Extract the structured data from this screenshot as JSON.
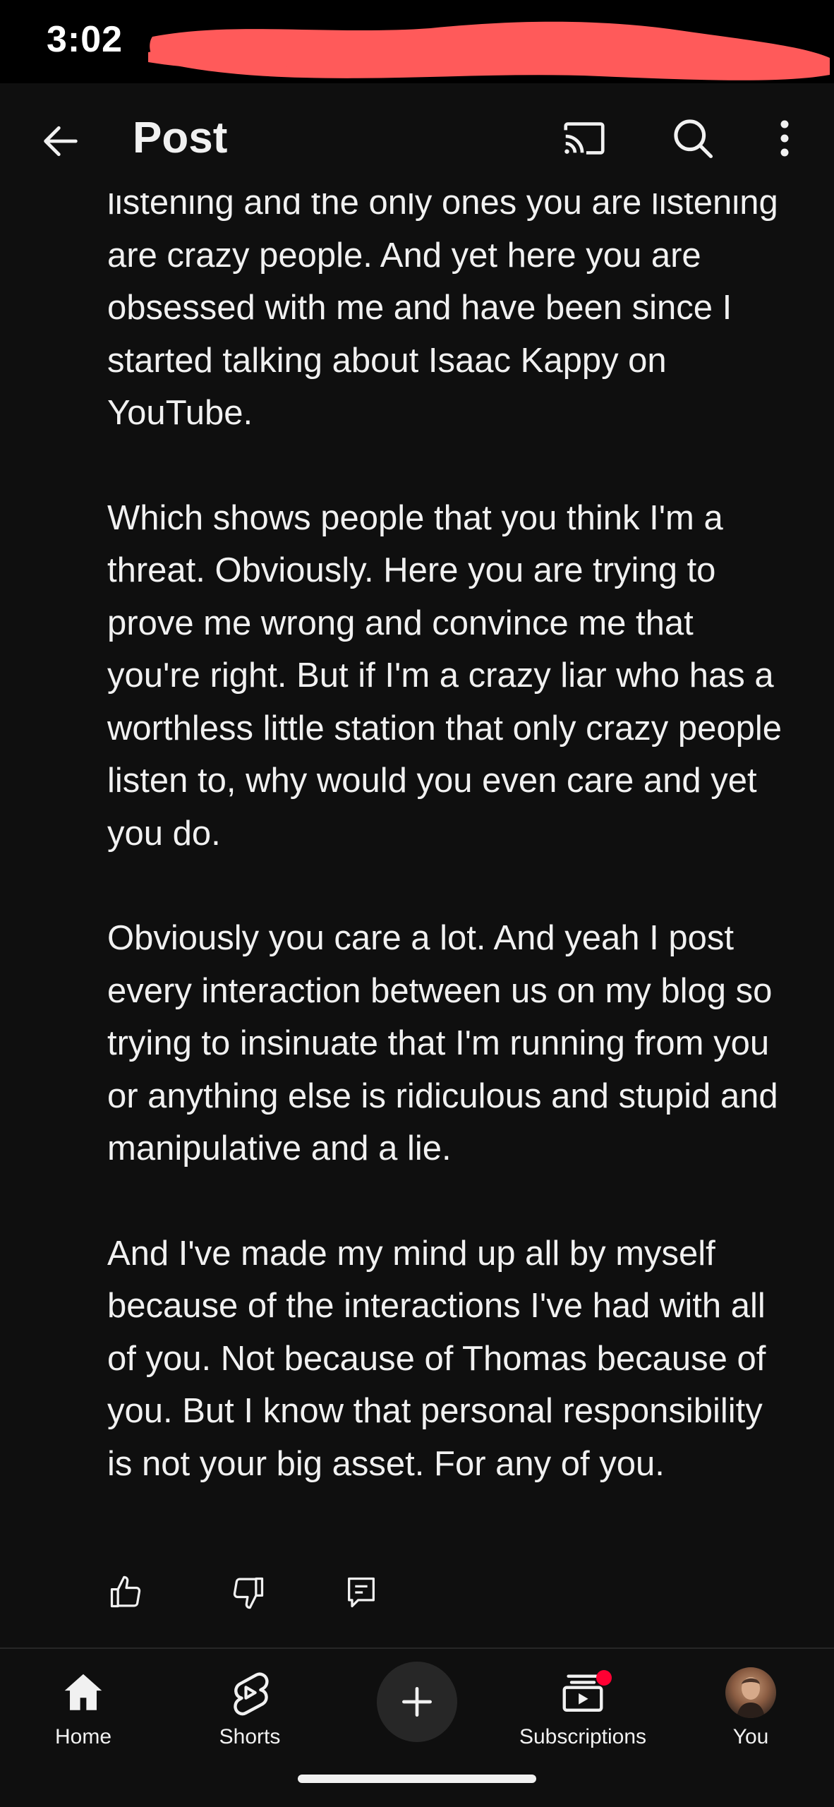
{
  "status_bar": {
    "time": "3:02"
  },
  "header": {
    "title": "Post",
    "icons": {
      "back": "back-arrow-icon",
      "cast": "cast-icon",
      "search": "search-icon",
      "more": "more-vert-icon"
    }
  },
  "post": {
    "paragraphs": [
      "listening and the only ones you are listening are crazy people. And yet here you are obsessed with me and have been since I started talking about Isaac Kappy on YouTube.",
      "Which shows people that you think I'm a threat. Obviously. Here you are trying to prove me wrong and convince me that you're right. But if I'm a crazy liar who has a worthless little station that only crazy people listen to, why would you even care and yet you do.",
      "Obviously you care a lot. And yeah I post every interaction between us on my blog so trying to insinuate that I'm running from you or anything else is ridiculous and stupid and manipulative and a lie.",
      "And I've made my mind up all by myself because of the interactions I've had with all of you. Not because of Thomas because of you. But I know that personal responsibility is not your big asset. For any of you."
    ],
    "actions": {
      "like": "thumbs-up-icon",
      "dislike": "thumbs-down-icon",
      "comment": "comment-icon"
    }
  },
  "bottom_nav": {
    "items": [
      {
        "label": "Home",
        "icon": "home-icon"
      },
      {
        "label": "Shorts",
        "icon": "shorts-icon"
      },
      {
        "label": "",
        "icon": "plus-icon"
      },
      {
        "label": "Subscriptions",
        "icon": "subscriptions-icon"
      },
      {
        "label": "You",
        "icon": "avatar"
      }
    ]
  },
  "colors": {
    "background": "#0f0f0f",
    "text": "#f1f1f1",
    "notification_dot": "#ff0033",
    "redaction": "#ff5a5a"
  }
}
